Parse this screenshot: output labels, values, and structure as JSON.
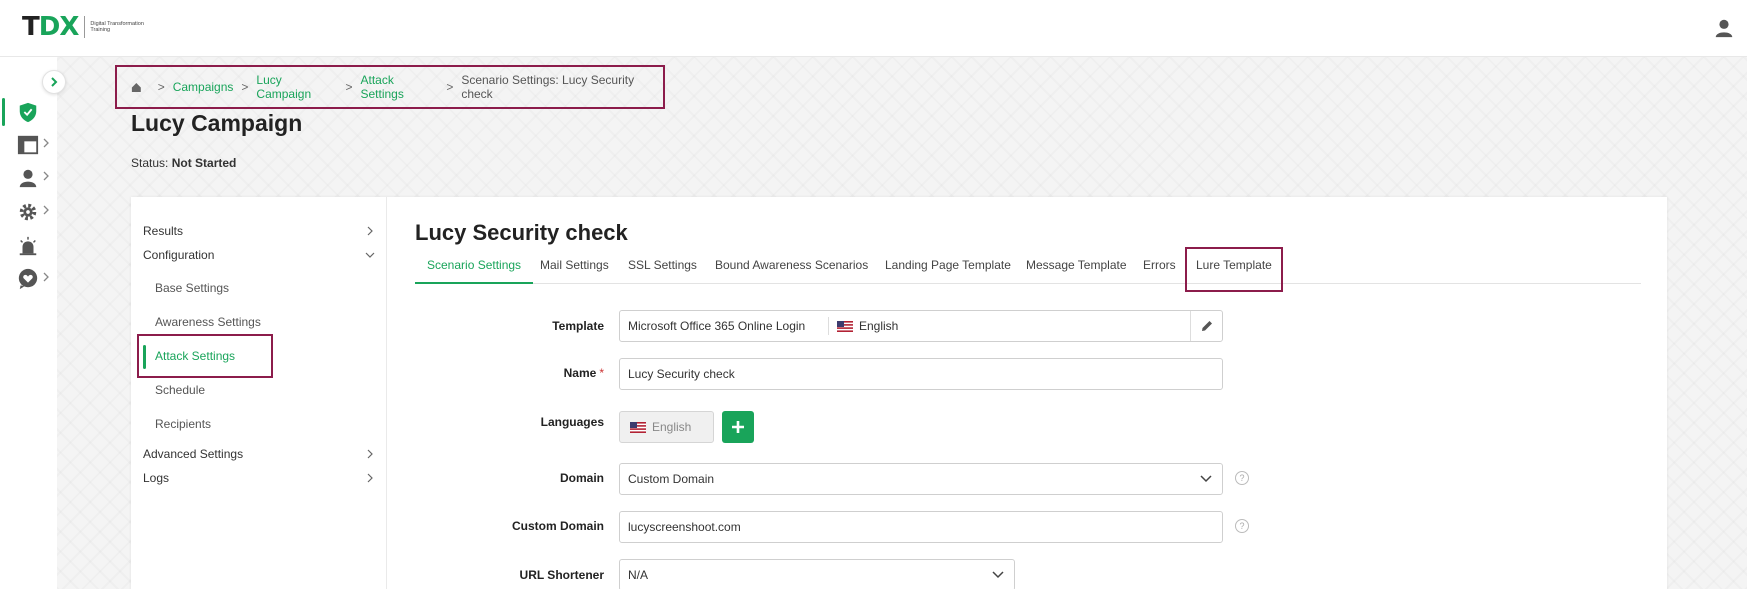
{
  "header": {
    "logo_main": "TDX",
    "logo_sub": "Digital Transformation Training",
    "user_icon": "user-icon"
  },
  "breadcrumb": {
    "home_icon": "home-icon",
    "items": [
      "Campaigns",
      "Lucy Campaign",
      "Attack Settings"
    ],
    "current": "Scenario Settings: Lucy Security check"
  },
  "page": {
    "title": "Lucy Campaign",
    "status_label": "Status:",
    "status_value": "Not Started"
  },
  "sidebar": {
    "items": [
      {
        "label": "Results"
      },
      {
        "label": "Configuration"
      },
      {
        "label": "Base Settings"
      },
      {
        "label": "Awareness Settings"
      },
      {
        "label": "Attack Settings"
      },
      {
        "label": "Schedule"
      },
      {
        "label": "Recipients"
      },
      {
        "label": "Advanced Settings"
      },
      {
        "label": "Logs"
      }
    ]
  },
  "main": {
    "title": "Lucy Security check",
    "tabs": [
      {
        "label": "Scenario Settings"
      },
      {
        "label": "Mail Settings"
      },
      {
        "label": "SSL Settings"
      },
      {
        "label": "Bound Awareness Scenarios"
      },
      {
        "label": "Landing Page Template"
      },
      {
        "label": "Message Template"
      },
      {
        "label": "Errors"
      },
      {
        "label": "Lure Template"
      }
    ]
  },
  "form": {
    "template": {
      "label": "Template",
      "value": "Microsoft Office 365 Online Login",
      "language": "English"
    },
    "name": {
      "label": "Name",
      "required_mark": "*",
      "value": "Lucy Security check"
    },
    "languages": {
      "label": "Languages",
      "value": "English"
    },
    "domain": {
      "label": "Domain",
      "value": "Custom Domain"
    },
    "custom_domain": {
      "label": "Custom Domain",
      "value": "lucyscreenshoot.com"
    },
    "url_shortener": {
      "label": "URL Shortener",
      "value": "N/A"
    },
    "help_glyph": "?"
  },
  "colors": {
    "accent": "#19a45a",
    "highlight": "#8c1c4b"
  }
}
